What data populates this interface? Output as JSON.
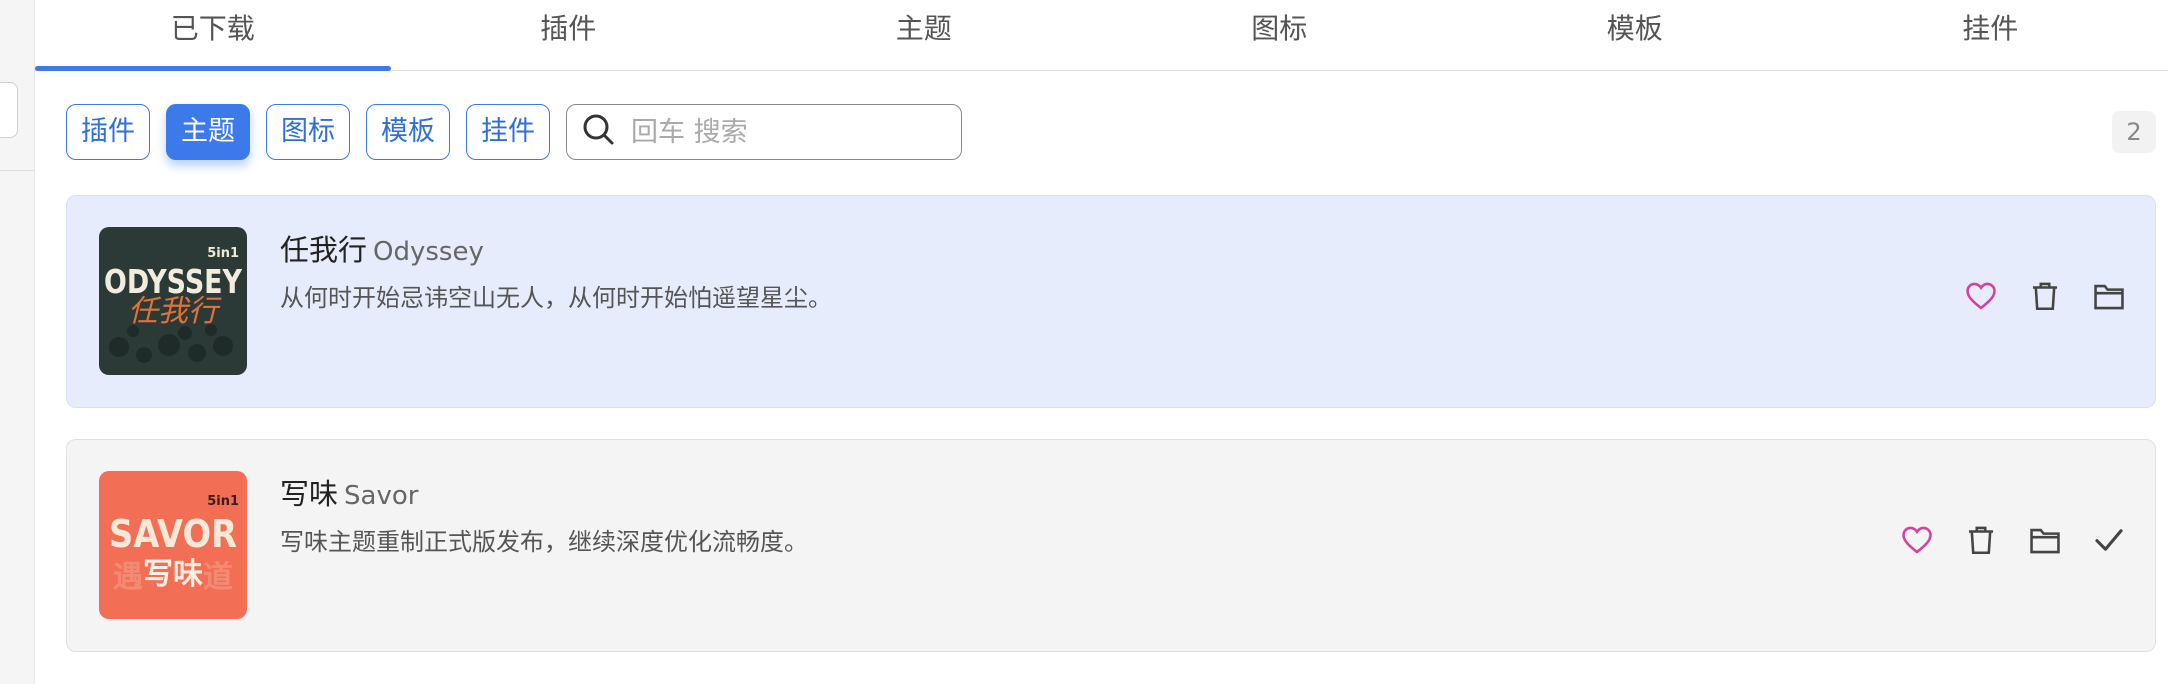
{
  "tabs": [
    {
      "label": "已下载",
      "active": true
    },
    {
      "label": "插件"
    },
    {
      "label": "主题"
    },
    {
      "label": "图标"
    },
    {
      "label": "模板"
    },
    {
      "label": "挂件"
    }
  ],
  "filters": [
    {
      "label": "插件"
    },
    {
      "label": "主题",
      "active": true
    },
    {
      "label": "图标"
    },
    {
      "label": "模板"
    },
    {
      "label": "挂件"
    }
  ],
  "search": {
    "placeholder": "回车 搜索",
    "value": ""
  },
  "count": "2",
  "items": [
    {
      "name": "任我行",
      "name_en": "Odyssey",
      "desc": "从何时开始忌讳空山无人，从何时开始怕遥望星尘。",
      "thumb": {
        "badge": "5in1",
        "title": "ODYSSEY",
        "subtitle": "任我行"
      }
    },
    {
      "name": "写味",
      "name_en": "Savor",
      "desc": "写味主题重制正式版发布，继续深度优化流畅度。",
      "thumb": {
        "badge": "5in1",
        "title": "SAVOR",
        "subtitle": "写味"
      }
    }
  ],
  "colors": {
    "accent": "#3b7ae8",
    "heart": "#d6409f",
    "selected_card": "#e6ecfb"
  }
}
